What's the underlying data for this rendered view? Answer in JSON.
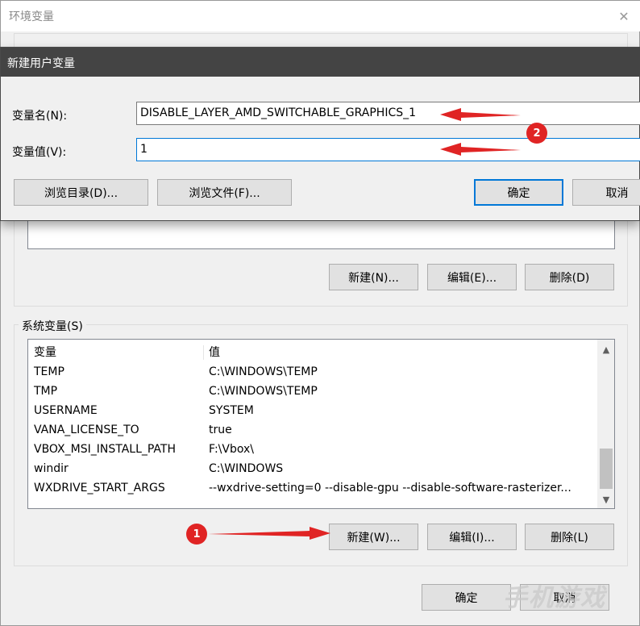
{
  "outer_window": {
    "title": "环境变量",
    "user_vars": {
      "buttons": {
        "new": "新建(N)...",
        "edit": "编辑(E)...",
        "delete": "删除(D)"
      }
    },
    "system_vars": {
      "group_label": "系统变量(S)",
      "columns": [
        "变量",
        "值"
      ],
      "rows": [
        {
          "name": "TEMP",
          "value": "C:\\WINDOWS\\TEMP"
        },
        {
          "name": "TMP",
          "value": "C:\\WINDOWS\\TEMP"
        },
        {
          "name": "USERNAME",
          "value": "SYSTEM"
        },
        {
          "name": "VANA_LICENSE_TO",
          "value": "true"
        },
        {
          "name": "VBOX_MSI_INSTALL_PATH",
          "value": "F:\\Vbox\\"
        },
        {
          "name": "windir",
          "value": "C:\\WINDOWS"
        },
        {
          "name": "WXDRIVE_START_ARGS",
          "value": "--wxdrive-setting=0 --disable-gpu --disable-software-rasterizer..."
        }
      ],
      "buttons": {
        "new": "新建(W)...",
        "edit": "编辑(I)...",
        "delete": "删除(L)"
      }
    },
    "footer": {
      "ok": "确定",
      "cancel": "取消"
    }
  },
  "dialog": {
    "title": "新建用户变量",
    "name_label": "变量名(N):",
    "name_value": "DISABLE_LAYER_AMD_SWITCHABLE_GRAPHICS_1",
    "value_label": "变量值(V):",
    "value_value": "1",
    "browse_dir": "浏览目录(D)...",
    "browse_file": "浏览文件(F)...",
    "ok": "确定",
    "cancel": "取消"
  },
  "annotations": {
    "badge_1": "1",
    "badge_2": "2",
    "arrow_color": "#e02424"
  },
  "watermark": "手机游戏",
  "colors": {
    "accent": "#0078d7",
    "dialog_titlebar": "#444444"
  }
}
